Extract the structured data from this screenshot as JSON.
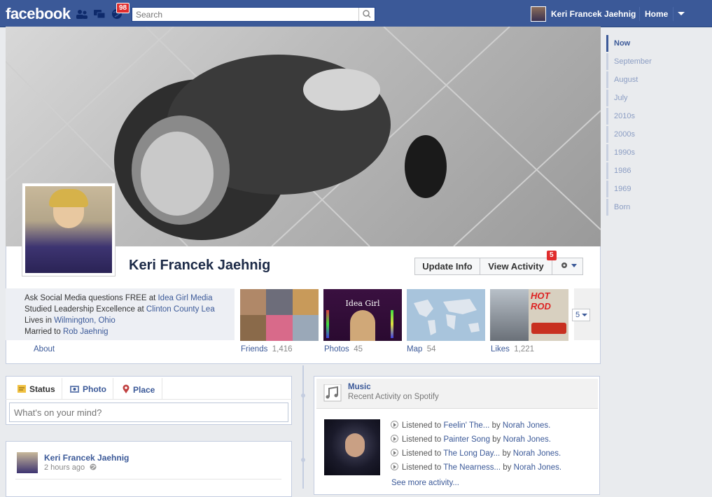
{
  "topbar": {
    "logo": "facebook",
    "notifications_count": "98",
    "search_placeholder": "Search",
    "user_name": "Keri Francek Jaehnig",
    "home_label": "Home"
  },
  "timeline_nav": [
    "Now",
    "September",
    "August",
    "July",
    "2010s",
    "2000s",
    "1990s",
    "1986",
    "1969",
    "Born"
  ],
  "profile": {
    "name": "Keri Francek Jaehnig",
    "update_info": "Update Info",
    "view_activity": "View Activity",
    "activity_badge": "5",
    "info": [
      {
        "prefix": "Ask Social Media questions FREE at ",
        "link": "Idea Girl Media"
      },
      {
        "prefix": "Studied Leadership Excellence at ",
        "link": "Clinton County Lea"
      },
      {
        "prefix": "Lives in ",
        "link": "Wilmington, Ohio"
      },
      {
        "prefix": "Married to ",
        "link": "Rob Jaehnig"
      }
    ],
    "about_label": "About",
    "tiles": [
      {
        "label": "Friends",
        "count": "1,416"
      },
      {
        "label": "Photos",
        "count": "45"
      },
      {
        "label": "Map",
        "count": "54"
      },
      {
        "label": "Likes",
        "count": "1,221"
      }
    ],
    "photo_tile_text": "Idea Girl",
    "likes_tile_text": "HOT ROD",
    "more_count": "5"
  },
  "composer": {
    "tabs": [
      "Status",
      "Photo",
      "Place"
    ],
    "placeholder": "What's on your mind?"
  },
  "post": {
    "author": "Keri Francek Jaehnig",
    "time": "2 hours ago"
  },
  "music": {
    "title": "Music",
    "subtitle": "Recent Activity on Spotify",
    "listens": [
      {
        "prefix": "Listened to ",
        "song": "Feelin' The...",
        "by": " by ",
        "artist": "Norah Jones."
      },
      {
        "prefix": "Listened to ",
        "song": "Painter Song",
        "by": " by ",
        "artist": "Norah Jones."
      },
      {
        "prefix": "Listened to ",
        "song": "The Long Day...",
        "by": " by ",
        "artist": "Norah Jones."
      },
      {
        "prefix": "Listened to ",
        "song": "The Nearness...",
        "by": " by ",
        "artist": "Norah Jones."
      }
    ],
    "see_more": "See more activity..."
  }
}
